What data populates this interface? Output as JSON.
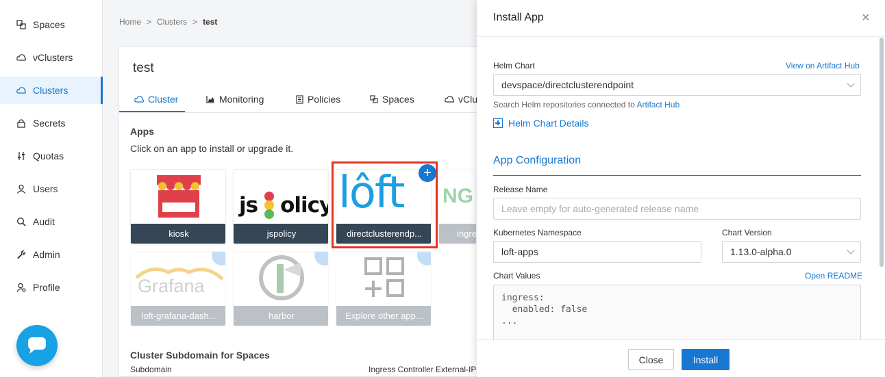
{
  "sidebar": {
    "items": [
      {
        "label": "Spaces",
        "icon": "spaces-icon"
      },
      {
        "label": "vClusters",
        "icon": "vcluster-icon"
      },
      {
        "label": "Clusters",
        "icon": "cloud-icon"
      },
      {
        "label": "Secrets",
        "icon": "lock-icon"
      },
      {
        "label": "Quotas",
        "icon": "sliders-icon"
      },
      {
        "label": "Users",
        "icon": "user-icon"
      },
      {
        "label": "Audit",
        "icon": "search-icon"
      },
      {
        "label": "Admin",
        "icon": "wrench-icon"
      },
      {
        "label": "Profile",
        "icon": "user-gear-icon"
      }
    ],
    "active_index": 2
  },
  "breadcrumb": {
    "home": "Home",
    "sep": ">",
    "clusters": "Clusters",
    "current": "test"
  },
  "card": {
    "title": "test",
    "tabs": [
      {
        "label": "Cluster",
        "icon": "cloud-icon"
      },
      {
        "label": "Monitoring",
        "icon": "chart-icon"
      },
      {
        "label": "Policies",
        "icon": "document-icon"
      },
      {
        "label": "Spaces",
        "icon": "spaces-icon"
      },
      {
        "label": "vClu",
        "icon": "vcluster-icon"
      }
    ],
    "apps_heading": "Apps",
    "apps_subtitle": "Click on an app to install or upgrade it.",
    "apps": [
      {
        "label": "kiosk"
      },
      {
        "label": "jspolicy",
        "logo_text_a": "js",
        "logo_text_b": "olicy"
      },
      {
        "label": "directclusterendp...",
        "logo_text": "lôft"
      },
      {
        "label": "ingre",
        "logo_text": "NG"
      },
      {
        "label": "loft-grafana-dash...",
        "logo_text": "Grafana"
      },
      {
        "label": "harbor"
      },
      {
        "label": "Explore other app..."
      }
    ],
    "subdomain_heading": "Cluster Subdomain for Spaces",
    "subdomain_label": "Subdomain",
    "ingress_label": "Ingress Controller External-IP"
  },
  "drawer": {
    "title": "Install App",
    "close_icon": "×",
    "helm_chart_label": "Helm Chart",
    "artifact_link": "View on Artifact Hub",
    "helm_chart_value": "devspace/directclusterendpoint",
    "helm_hint": "Search Helm repositories connected to",
    "helm_hint_link": "Artifact Hub",
    "helm_details": "Helm Chart Details",
    "app_config_heading": "App Configuration",
    "release_name_label": "Release Name",
    "release_name_placeholder": "Leave empty for auto-generated release name",
    "namespace_label": "Kubernetes Namespace",
    "namespace_value": "loft-apps",
    "chart_version_label": "Chart Version",
    "chart_version_value": "1.13.0-alpha.0",
    "chart_values_label": "Chart Values",
    "open_readme": "Open README",
    "chart_values": "ingress:\n  enabled: false\n...",
    "close_button": "Close",
    "install_button": "Install"
  },
  "colors": {
    "accent": "#1877d0",
    "highlight": "#e63320",
    "tile_label": "#354656",
    "chat": "#17a2e6"
  }
}
